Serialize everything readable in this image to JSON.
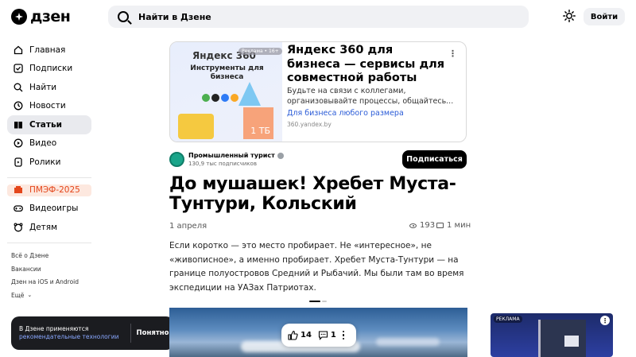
{
  "header": {
    "logo_text": "дзен",
    "search_placeholder": "Найти в Дзене",
    "login_label": "Войти"
  },
  "sidebar": {
    "items": [
      {
        "label": "Главная",
        "icon": "home-icon"
      },
      {
        "label": "Подписки",
        "icon": "subscriptions-icon"
      },
      {
        "label": "Найти",
        "icon": "search-icon"
      },
      {
        "label": "Новости",
        "icon": "news-icon"
      },
      {
        "label": "Статьи",
        "icon": "articles-icon",
        "active": true
      },
      {
        "label": "Видео",
        "icon": "video-icon"
      },
      {
        "label": "Ролики",
        "icon": "shorts-icon"
      }
    ],
    "special": [
      {
        "label": "ПМЭФ-2025",
        "icon": "pmef-icon"
      },
      {
        "label": "Видеоигры",
        "icon": "gamepad-icon"
      },
      {
        "label": "Детям",
        "icon": "kids-icon"
      }
    ],
    "links": [
      "Всё о Дзене",
      "Вакансии",
      "Дзен на iOS и Android",
      "Ещё"
    ]
  },
  "ad": {
    "brand": "Яндекс 360",
    "badge": "Реклама • 16+",
    "image_caption": "Инструменты для бизнеса",
    "box_label": "1 ТБ",
    "title": "Яндекс 360 для бизнеса — сервисы для совместной работы",
    "description": "Будьте на связи с коллегами, организовывайте процессы, общайтесь...",
    "link": "Для бизнеса любого размера",
    "domain": "360.yandex.by"
  },
  "channel": {
    "name": "Промышленный турист",
    "subscribers": "130,9 тыс подписчиков",
    "subscribe_label": "Подписаться"
  },
  "article": {
    "title": "До мушашек! Хребет Муста-Тунтури, Кольский",
    "date": "1 апреля",
    "views": "193",
    "read_time": "1 мин",
    "body": "Если коротко — это место пробирает. Не «интересное», не «живописное», а именно пробирает. Хребет Муста-Тунтури — на границе полуостровов Средний и Рыбачий. Мы были там во время экспедиции на УАЗах Патриотах."
  },
  "actions": {
    "likes": "14",
    "comments": "1"
  },
  "cookie": {
    "text": "В Дзене применяются",
    "link": "рекомендательные технологии",
    "button": "Понятно"
  },
  "side_ad": {
    "badge": "РЕКЛАМА"
  }
}
